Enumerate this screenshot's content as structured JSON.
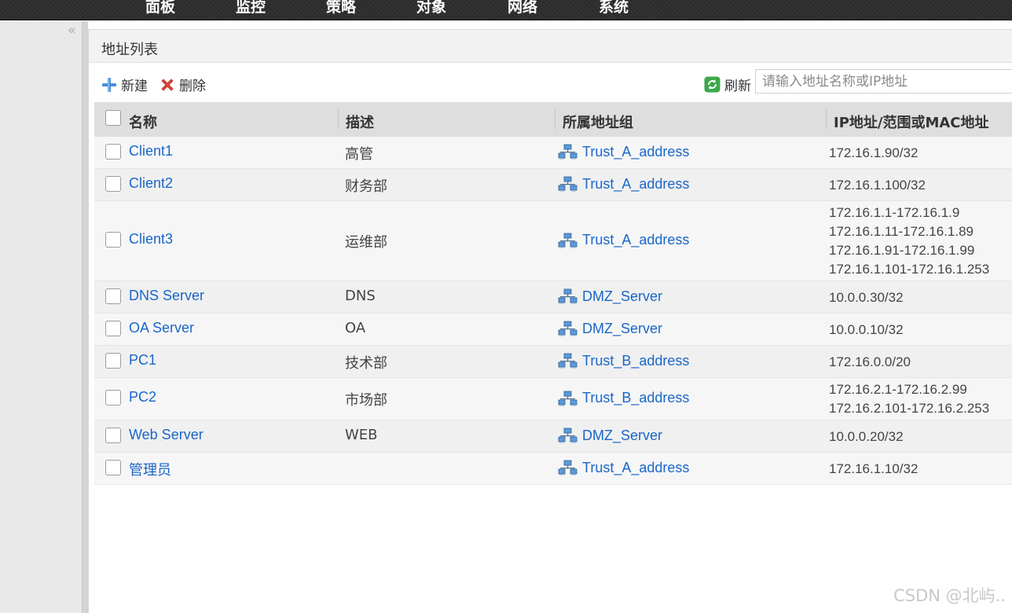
{
  "nav": {
    "items": [
      "面板",
      "监控",
      "策略",
      "对象",
      "网络",
      "系统"
    ]
  },
  "sidebar": {
    "collapse_glyph": "«"
  },
  "panel": {
    "title": "地址列表"
  },
  "toolbar": {
    "new_label": "新建",
    "delete_label": "删除",
    "refresh_label": "刷新",
    "search_placeholder": "请输入地址名称或IP地址"
  },
  "table": {
    "headers": {
      "name": "名称",
      "desc": "描述",
      "group": "所属地址组",
      "ip": "IP地址/范围或MAC地址"
    },
    "rows": [
      {
        "name": "Client1",
        "desc": "高管",
        "group": "Trust_A_address",
        "ip": [
          "172.16.1.90/32"
        ]
      },
      {
        "name": "Client2",
        "desc": "财务部",
        "group": "Trust_A_address",
        "ip": [
          "172.16.1.100/32"
        ]
      },
      {
        "name": "Client3",
        "desc": "运维部",
        "group": "Trust_A_address",
        "ip": [
          "172.16.1.1-172.16.1.9",
          "172.16.1.11-172.16.1.89",
          "172.16.1.91-172.16.1.99",
          "172.16.1.101-172.16.1.253"
        ]
      },
      {
        "name": "DNS Server",
        "desc": "DNS",
        "group": "DMZ_Server",
        "ip": [
          "10.0.0.30/32"
        ]
      },
      {
        "name": "OA Server",
        "desc": "OA",
        "group": "DMZ_Server",
        "ip": [
          "10.0.0.10/32"
        ]
      },
      {
        "name": "PC1",
        "desc": "技术部",
        "group": "Trust_B_address",
        "ip": [
          "172.16.0.0/20"
        ]
      },
      {
        "name": "PC2",
        "desc": "市场部",
        "group": "Trust_B_address",
        "ip": [
          "172.16.2.1-172.16.2.99",
          "172.16.2.101-172.16.2.253"
        ]
      },
      {
        "name": "Web Server",
        "desc": "WEB",
        "group": "DMZ_Server",
        "ip": [
          "10.0.0.20/32"
        ]
      },
      {
        "name": "管理员",
        "desc": "",
        "group": "Trust_A_address",
        "ip": [
          "172.16.1.10/32"
        ]
      }
    ]
  },
  "watermark": "CSDN @北屿..",
  "colors": {
    "link": "#1a66c9",
    "nav_bg": "#2b2b2b",
    "header_bg": "#dedede"
  }
}
